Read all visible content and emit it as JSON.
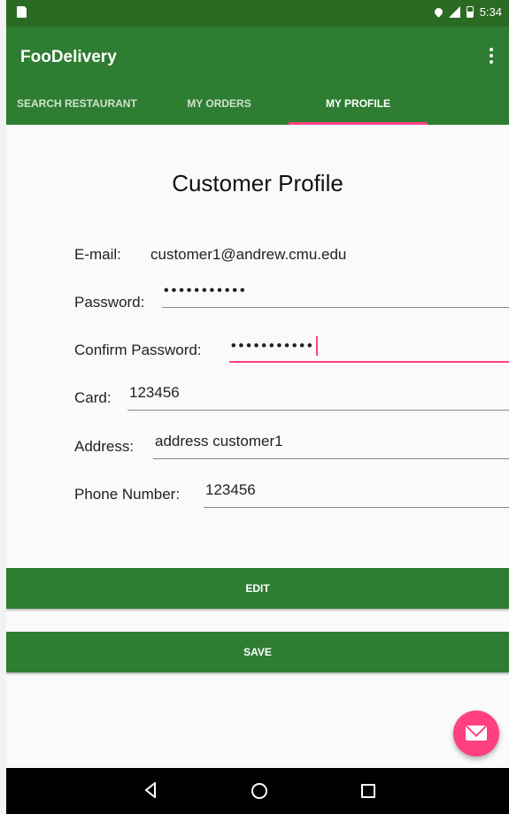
{
  "status_bar": {
    "time": "5:34"
  },
  "app_bar": {
    "title": "FooDelivery"
  },
  "tabs": [
    {
      "label": "SEARCH RESTAURANT",
      "active": false
    },
    {
      "label": "MY ORDERS",
      "active": false
    },
    {
      "label": "MY PROFILE",
      "active": true
    }
  ],
  "profile": {
    "heading": "Customer Profile",
    "email_label": "E-mail:",
    "email_value": "customer1@andrew.cmu.edu",
    "password_label": "Password:",
    "password_value": "•••••••••••",
    "confirm_label": "Confirm Password:",
    "confirm_value": "•••••••••••",
    "card_label": "Card:",
    "card_value": "123456",
    "address_label": "Address:",
    "address_value": "address customer1",
    "phone_label": "Phone Number:",
    "phone_value": "123456"
  },
  "buttons": {
    "edit": "EDIT",
    "save": "SAVE"
  },
  "fab": {
    "icon": "mail-icon"
  },
  "navigation": {
    "back_icon": "back-icon",
    "home_icon": "home-icon",
    "recents_icon": "recents-icon"
  },
  "colors": {
    "primary": "#2e7d32",
    "status_bar": "#2b6a23",
    "accent": "#ff4081"
  }
}
